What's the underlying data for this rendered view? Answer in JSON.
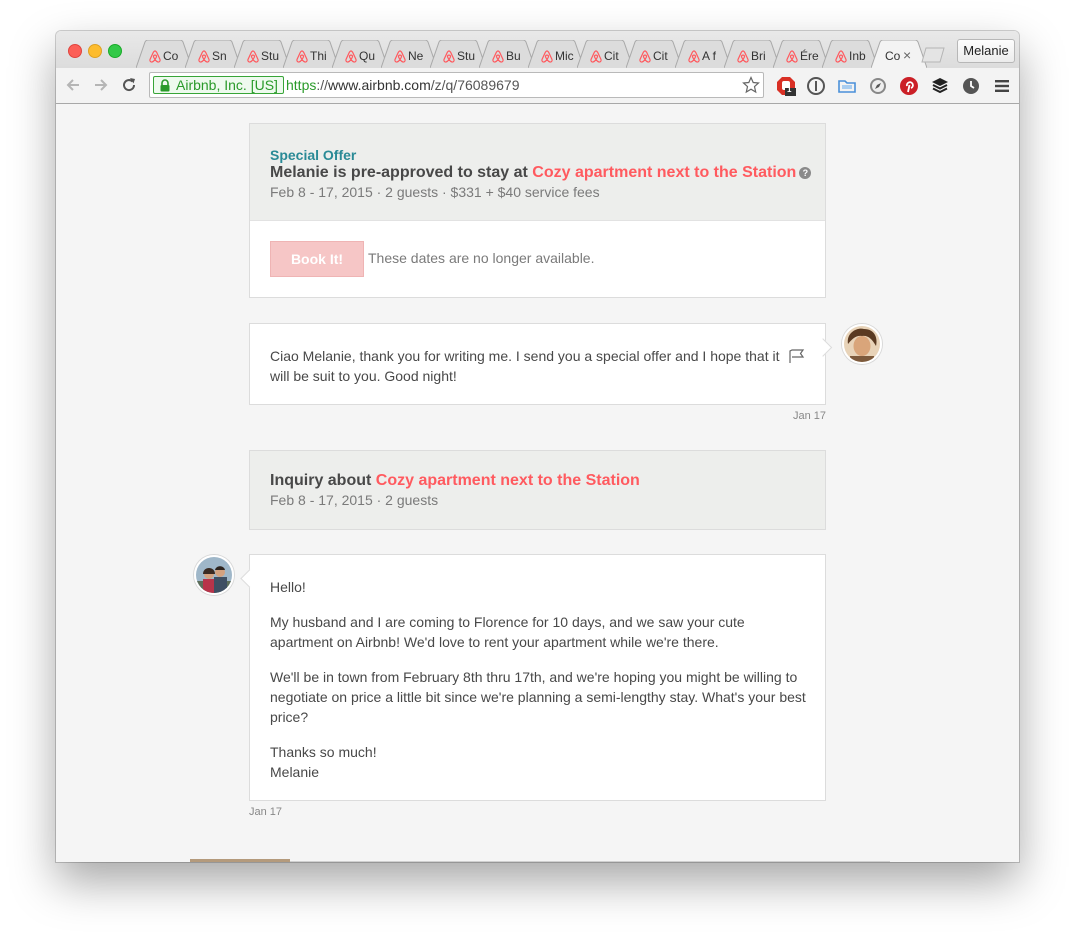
{
  "browser": {
    "tabs": [
      {
        "label": "Co",
        "active": false
      },
      {
        "label": "Sn",
        "active": false
      },
      {
        "label": "Stu",
        "active": false
      },
      {
        "label": "Thi",
        "active": false
      },
      {
        "label": "Qu",
        "active": false
      },
      {
        "label": "Ne",
        "active": false
      },
      {
        "label": "Stu",
        "active": false
      },
      {
        "label": "Bu",
        "active": false
      },
      {
        "label": "Mic",
        "active": false
      },
      {
        "label": "Cit",
        "active": false
      },
      {
        "label": "Cit",
        "active": false
      },
      {
        "label": "A f",
        "active": false
      },
      {
        "label": "Bri",
        "active": false
      },
      {
        "label": "Ére",
        "active": false
      },
      {
        "label": "Inb",
        "active": false
      },
      {
        "label": "Co",
        "active": true
      }
    ],
    "tab_close_glyph": "×",
    "profile_name": "Melanie",
    "ev_label": "Airbnb, Inc. [US]",
    "url_scheme": "https",
    "url_separator": "://",
    "url_host": "www.airbnb.com",
    "url_path": "/z/q/76089679",
    "extension_badge": "1",
    "accent_color": "#ff5a5f",
    "teal_color": "#2a8a96"
  },
  "offer": {
    "label": "Special Offer",
    "title_prefix": "Melanie is pre-approved to stay at ",
    "listing_name": "Cozy apartment next to the Station",
    "help_glyph": "?",
    "details": "Feb 8 - 17, 2015 · 2 guests · $331 + $40 service fees",
    "book_button": "Book It!",
    "unavailable_text": "These dates are no longer available."
  },
  "host_message": {
    "text": "Ciao Melanie, thank you for writing me. I send you a special offer and I hope that it will be suit to you. Good night!",
    "date": "Jan 17"
  },
  "inquiry": {
    "title_prefix": "Inquiry about ",
    "listing_name": "Cozy apartment next to the Station",
    "details": "Feb 8 - 17, 2015 · 2 guests"
  },
  "guest_message": {
    "greeting": "Hello!",
    "paragraph1": "My husband and I are coming to Florence for 10 days, and we saw your cute apartment on Airbnb! We'd love to rent your apartment while we're there.",
    "paragraph2": "We'll be in town from February 8th thru 17th, and we're hoping you might be willing to negotiate on price a little bit since we're planning a semi-lengthy stay. What's your best price?",
    "closing": "Thanks so much!",
    "signature": "Melanie",
    "date": "Jan 17"
  }
}
